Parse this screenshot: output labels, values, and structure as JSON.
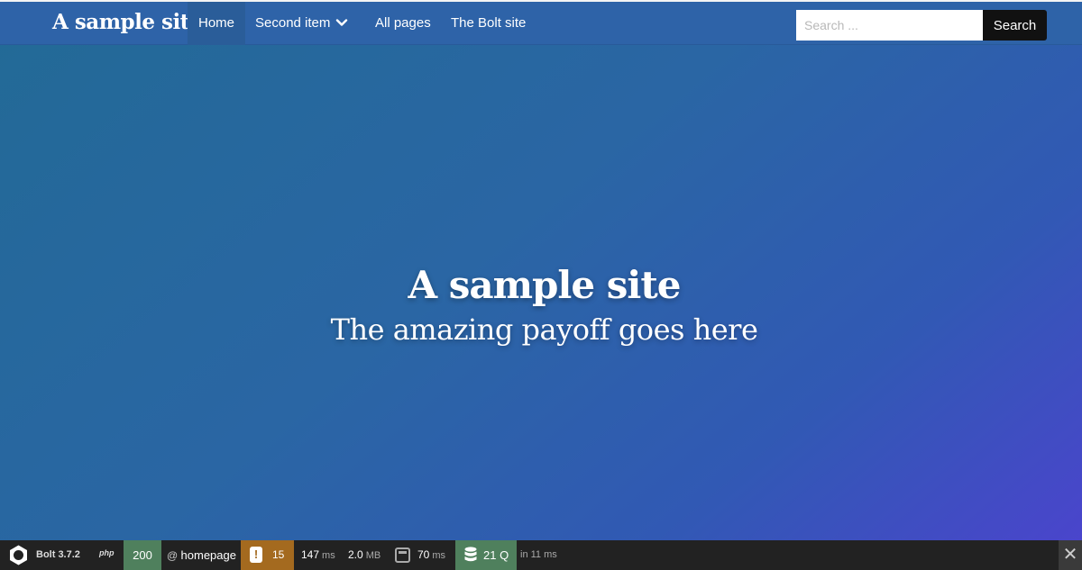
{
  "navbar": {
    "brand": "A sample site",
    "items": [
      {
        "label": "Home"
      },
      {
        "label": "Second item"
      },
      {
        "label": "All pages"
      },
      {
        "label": "The Bolt site"
      }
    ],
    "search": {
      "placeholder": "Search ...",
      "button_label": "Search"
    }
  },
  "hero": {
    "title": "A sample site",
    "subtitle": "The amazing payoff goes here"
  },
  "debug_toolbar": {
    "version": "Bolt 3.7.2",
    "php_label": "php",
    "status_code": "200",
    "route_prefix": "@",
    "route": "homepage",
    "warnings": "15",
    "time_value": "147",
    "time_unit": "ms",
    "memory_value": "2.0",
    "memory_unit": "MB",
    "twig_value": "70",
    "twig_unit": "ms",
    "db_queries": "21 Q",
    "db_time": "in 11 ms",
    "close_label": "✕"
  },
  "colors": {
    "navbar_bg": "#2e63a8",
    "hero_gradient_start": "#226a96",
    "hero_gradient_end": "#4a45cc",
    "status_green": "#4f805d",
    "warning_amber": "#a46a1f",
    "toolbar_bg": "#222222"
  }
}
